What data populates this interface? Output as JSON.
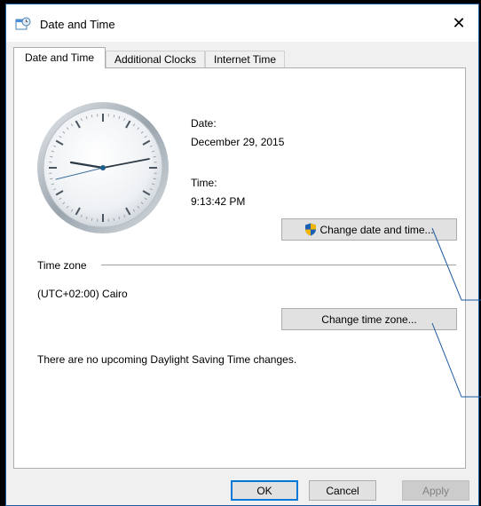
{
  "window": {
    "title": "Date and Time",
    "close_glyph": "✕"
  },
  "tabs": [
    {
      "label": "Date and Time",
      "active": true
    },
    {
      "label": "Additional Clocks",
      "active": false
    },
    {
      "label": "Internet Time",
      "active": false
    }
  ],
  "datetime": {
    "date_label": "Date:",
    "date_value": "December 29, 2015",
    "time_label": "Time:",
    "time_value": "9:13:42 PM",
    "change_button": "Change date and time..."
  },
  "timezone": {
    "section_label": "Time zone",
    "value": "(UTC+02:00) Cairo",
    "change_button": "Change time zone...",
    "dst_message": "There are no upcoming Daylight Saving Time changes."
  },
  "footer": {
    "ok": "OK",
    "cancel": "Cancel",
    "apply": "Apply"
  },
  "colors": {
    "accent": "#0078d7",
    "callout_line": "#1e5aa0"
  },
  "icons": {
    "title": "date-time-icon",
    "shield": "uac-shield-icon",
    "close": "close-icon"
  }
}
